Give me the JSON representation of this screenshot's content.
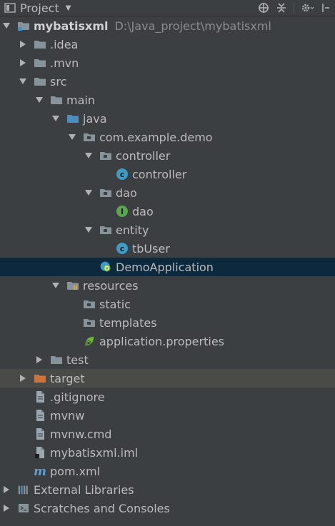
{
  "header": {
    "title": "Project",
    "icon": "project-panel-icon"
  },
  "tree": [
    {
      "label": "mybatisxml",
      "path": "D:\\Java_project\\mybatisxml",
      "level": 0,
      "arrow": "down",
      "icon": "module-folder-icon",
      "bold": true,
      "name": "tree-item-mybatisxml"
    },
    {
      "label": ".idea",
      "level": 1,
      "arrow": "right",
      "icon": "folder-icon",
      "name": "tree-item-idea"
    },
    {
      "label": ".mvn",
      "level": 1,
      "arrow": "right",
      "icon": "folder-icon",
      "name": "tree-item-mvn"
    },
    {
      "label": "src",
      "level": 1,
      "arrow": "down",
      "icon": "folder-icon",
      "name": "tree-item-src"
    },
    {
      "label": "main",
      "level": 2,
      "arrow": "down",
      "icon": "folder-icon",
      "name": "tree-item-main"
    },
    {
      "label": "java",
      "level": 3,
      "arrow": "down",
      "icon": "source-folder-icon",
      "name": "tree-item-java"
    },
    {
      "label": "com.example.demo",
      "level": 4,
      "arrow": "down",
      "icon": "package-icon",
      "name": "tree-item-com-example-demo"
    },
    {
      "label": "controller",
      "level": 5,
      "arrow": "down",
      "icon": "package-icon",
      "name": "tree-item-controller-package"
    },
    {
      "label": "controller",
      "level": 6,
      "arrow": "none",
      "icon": "class-icon",
      "name": "tree-item-controller-class"
    },
    {
      "label": "dao",
      "level": 5,
      "arrow": "down",
      "icon": "package-icon",
      "name": "tree-item-dao-package"
    },
    {
      "label": "dao",
      "level": 6,
      "arrow": "none",
      "icon": "interface-icon",
      "name": "tree-item-dao-interface"
    },
    {
      "label": "entity",
      "level": 5,
      "arrow": "down",
      "icon": "package-icon",
      "name": "tree-item-entity-package"
    },
    {
      "label": "tbUser",
      "level": 6,
      "arrow": "none",
      "icon": "class-icon",
      "name": "tree-item-tbuser-class"
    },
    {
      "label": "DemoApplication",
      "level": 5,
      "arrow": "none",
      "icon": "spring-boot-class-icon",
      "selected": true,
      "name": "tree-item-demoapplication"
    },
    {
      "label": "resources",
      "level": 3,
      "arrow": "down",
      "icon": "resources-folder-icon",
      "name": "tree-item-resources"
    },
    {
      "label": "static",
      "level": 4,
      "arrow": "none",
      "icon": "package-icon",
      "name": "tree-item-static"
    },
    {
      "label": "templates",
      "level": 4,
      "arrow": "none",
      "icon": "package-icon",
      "name": "tree-item-templates"
    },
    {
      "label": "application.properties",
      "level": 4,
      "arrow": "none",
      "icon": "spring-properties-icon",
      "name": "tree-item-application-properties"
    },
    {
      "label": "test",
      "level": 2,
      "arrow": "right",
      "icon": "folder-icon",
      "name": "tree-item-test"
    },
    {
      "label": "target",
      "level": 1,
      "arrow": "right",
      "icon": "excluded-folder-icon",
      "excluded": true,
      "name": "tree-item-target"
    },
    {
      "label": ".gitignore",
      "level": 1,
      "arrow": "none",
      "icon": "file-icon",
      "name": "tree-item-gitignore"
    },
    {
      "label": "mvnw",
      "level": 1,
      "arrow": "none",
      "icon": "file-icon",
      "name": "tree-item-mvnw"
    },
    {
      "label": "mvnw.cmd",
      "level": 1,
      "arrow": "none",
      "icon": "file-icon",
      "name": "tree-item-mvnw-cmd"
    },
    {
      "label": "mybatisxml.iml",
      "level": 1,
      "arrow": "none",
      "icon": "iml-file-icon",
      "name": "tree-item-mybatisxml-iml"
    },
    {
      "label": "pom.xml",
      "level": 1,
      "arrow": "none",
      "icon": "maven-icon",
      "name": "tree-item-pom-xml"
    },
    {
      "label": "External Libraries",
      "level": 0,
      "arrow": "right",
      "icon": "libraries-icon",
      "name": "tree-item-external-libraries"
    },
    {
      "label": "Scratches and Consoles",
      "level": 0,
      "arrow": "right",
      "icon": "scratches-icon",
      "name": "tree-item-scratches-and-consoles"
    }
  ],
  "colors": {
    "background": "#3c3f41",
    "selected_row": "#0d293e",
    "excluded_row": "#4a4a46",
    "text": "#bbbbbb",
    "path_text": "#8c8c8c",
    "folder": "#87939a",
    "source_folder": "#4a8fc2",
    "class": "#3d9bc6",
    "interface": "#5aa64f",
    "excluded_folder": "#d0733a"
  }
}
